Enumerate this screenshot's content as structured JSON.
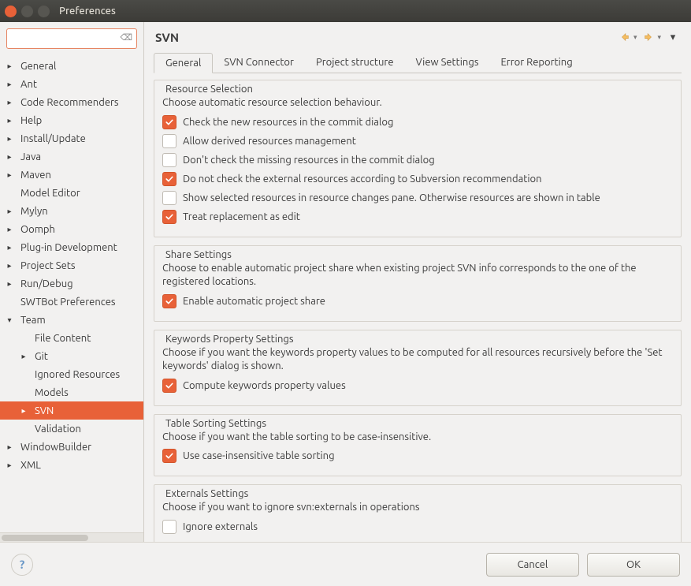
{
  "window": {
    "title": "Preferences"
  },
  "sidebar": {
    "filter_value": "",
    "items": [
      {
        "label": "General",
        "arrow": "right",
        "indent": 0
      },
      {
        "label": "Ant",
        "arrow": "right",
        "indent": 0
      },
      {
        "label": "Code Recommenders",
        "arrow": "right",
        "indent": 0
      },
      {
        "label": "Help",
        "arrow": "right",
        "indent": 0
      },
      {
        "label": "Install/Update",
        "arrow": "right",
        "indent": 0
      },
      {
        "label": "Java",
        "arrow": "right",
        "indent": 0
      },
      {
        "label": "Maven",
        "arrow": "right",
        "indent": 0
      },
      {
        "label": "Model Editor",
        "arrow": "none",
        "indent": 0
      },
      {
        "label": "Mylyn",
        "arrow": "right",
        "indent": 0
      },
      {
        "label": "Oomph",
        "arrow": "right",
        "indent": 0
      },
      {
        "label": "Plug-in Development",
        "arrow": "right",
        "indent": 0
      },
      {
        "label": "Project Sets",
        "arrow": "right",
        "indent": 0
      },
      {
        "label": "Run/Debug",
        "arrow": "right",
        "indent": 0
      },
      {
        "label": "SWTBot Preferences",
        "arrow": "none",
        "indent": 0
      },
      {
        "label": "Team",
        "arrow": "down",
        "indent": 0
      },
      {
        "label": "File Content",
        "arrow": "none",
        "indent": 1
      },
      {
        "label": "Git",
        "arrow": "right",
        "indent": 1
      },
      {
        "label": "Ignored Resources",
        "arrow": "none",
        "indent": 1
      },
      {
        "label": "Models",
        "arrow": "none",
        "indent": 1
      },
      {
        "label": "SVN",
        "arrow": "right",
        "indent": 1,
        "selected": true
      },
      {
        "label": "Validation",
        "arrow": "none",
        "indent": 1
      },
      {
        "label": "WindowBuilder",
        "arrow": "right",
        "indent": 0
      },
      {
        "label": "XML",
        "arrow": "right",
        "indent": 0
      }
    ]
  },
  "main": {
    "title": "SVN",
    "tabs": [
      "General",
      "SVN Connector",
      "Project structure",
      "View Settings",
      "Error Reporting"
    ],
    "active_tab": 0,
    "sections": {
      "resource": {
        "legend": "Resource Selection",
        "desc": "Choose automatic resource selection behaviour.",
        "options": [
          {
            "label": "Check the new resources in the commit dialog",
            "checked": true
          },
          {
            "label": "Allow derived resources management",
            "checked": false
          },
          {
            "label": "Don't check the missing resources in the commit dialog",
            "checked": false
          },
          {
            "label": "Do not check the external resources according to Subversion recommendation",
            "checked": true
          },
          {
            "label": "Show selected resources in resource changes pane. Otherwise resources are shown in table",
            "checked": false
          },
          {
            "label": "Treat replacement as edit",
            "checked": true
          }
        ]
      },
      "share": {
        "legend": "Share Settings",
        "desc": "Choose to enable automatic project share when existing project SVN info corresponds to the one of the registered locations.",
        "options": [
          {
            "label": "Enable automatic project share",
            "checked": true
          }
        ]
      },
      "keywords": {
        "legend": "Keywords Property Settings",
        "desc": "Choose if you want the keywords property values to be computed for all resources recursively before the 'Set keywords' dialog is shown.",
        "options": [
          {
            "label": "Compute keywords property values",
            "checked": true
          }
        ]
      },
      "sorting": {
        "legend": "Table Sorting Settings",
        "desc": "Choose if you want the table sorting to be case-insensitive.",
        "options": [
          {
            "label": "Use case-insensitive table sorting",
            "checked": true
          }
        ]
      },
      "externals": {
        "legend": "Externals Settings",
        "desc": "Choose if you want to ignore svn:externals in operations",
        "options": [
          {
            "label": "Ignore externals",
            "checked": false
          }
        ]
      }
    }
  },
  "footer": {
    "cancel": "Cancel",
    "ok": "OK"
  }
}
